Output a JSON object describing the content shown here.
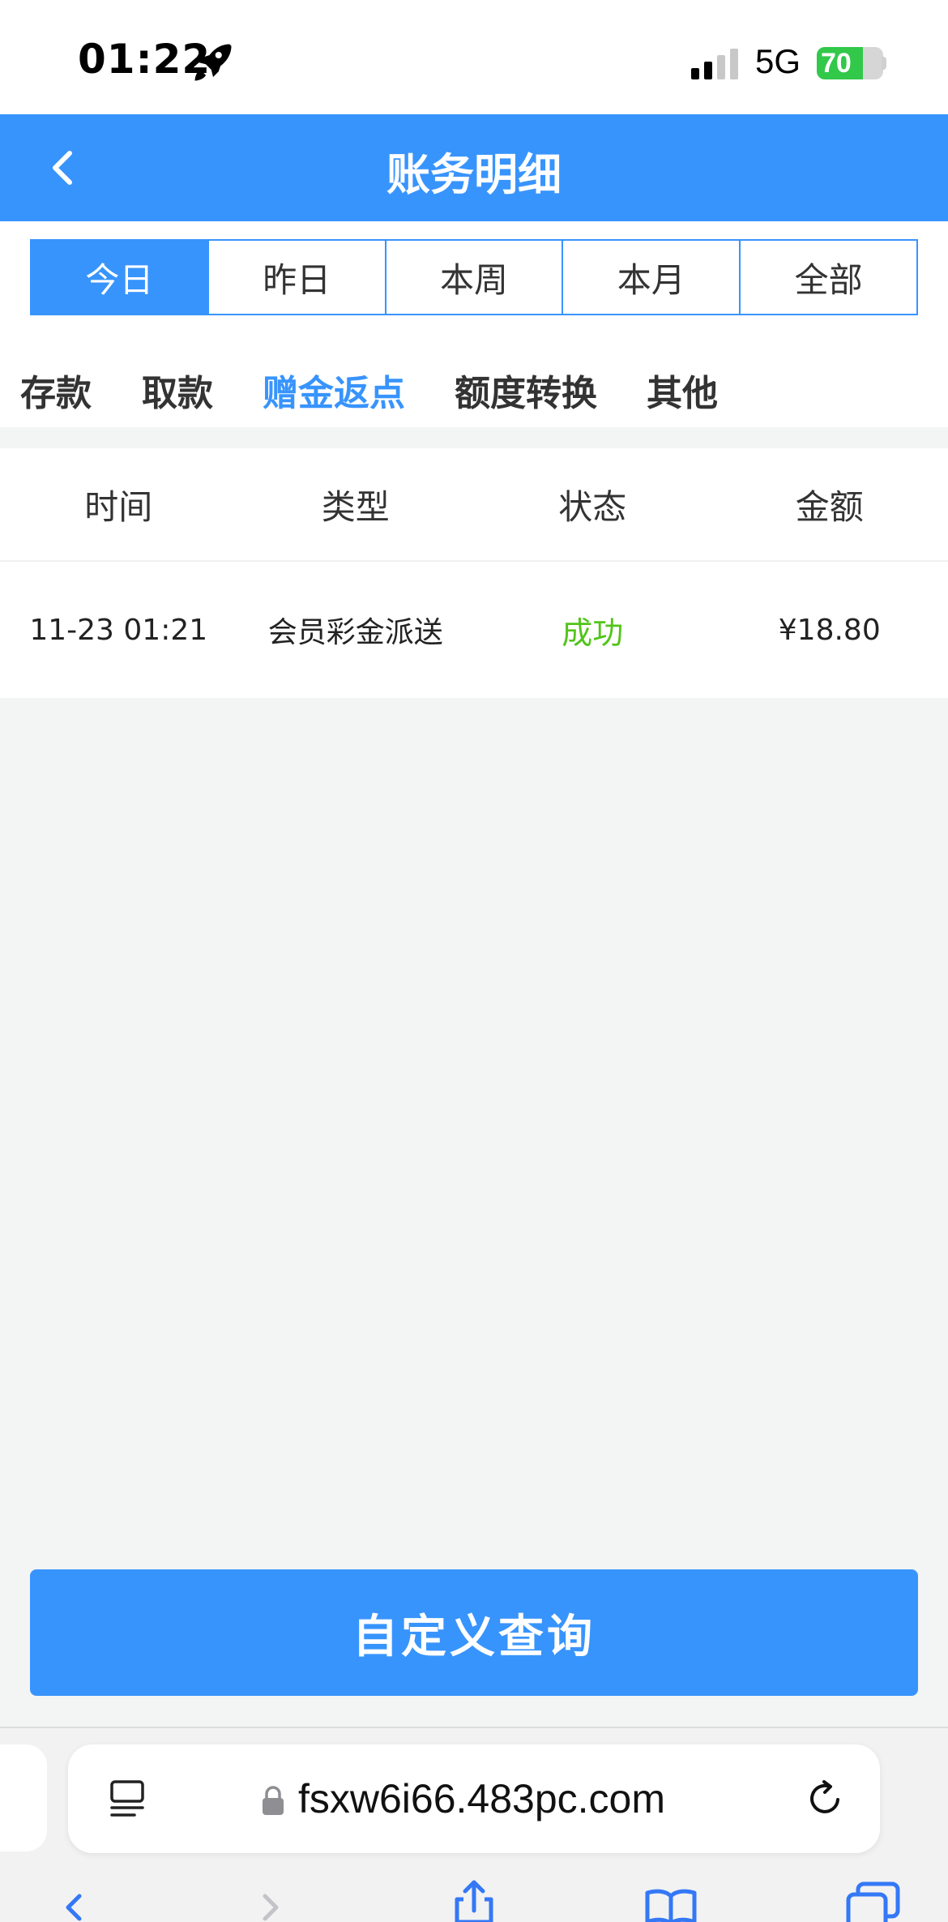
{
  "status_bar": {
    "time": "01:22",
    "network": "5G",
    "battery": "70",
    "battery_level": 0.7
  },
  "header": {
    "title": "账务明细"
  },
  "date_tabs": [
    {
      "label": "今日",
      "active": true
    },
    {
      "label": "昨日",
      "active": false
    },
    {
      "label": "本周",
      "active": false
    },
    {
      "label": "本月",
      "active": false
    },
    {
      "label": "全部",
      "active": false
    }
  ],
  "category_tabs": [
    {
      "label": "存款",
      "active": false
    },
    {
      "label": "取款",
      "active": false
    },
    {
      "label": "赠金返点",
      "active": true
    },
    {
      "label": "额度转换",
      "active": false
    },
    {
      "label": "其他",
      "active": false
    }
  ],
  "table": {
    "headers": [
      "时间",
      "类型",
      "状态",
      "金额"
    ],
    "rows": [
      {
        "time": "11-23 01:21",
        "type": "会员彩金派送",
        "status": "成功",
        "amount": "¥18.80"
      }
    ]
  },
  "query_button": {
    "label": "自定义查询"
  },
  "browser": {
    "url": "fsxw6i66.483pc.com"
  },
  "colors": {
    "primary": "#3894fd",
    "success": "#52c41a",
    "background": "#f3f4f4",
    "battery": "#32c84a"
  }
}
